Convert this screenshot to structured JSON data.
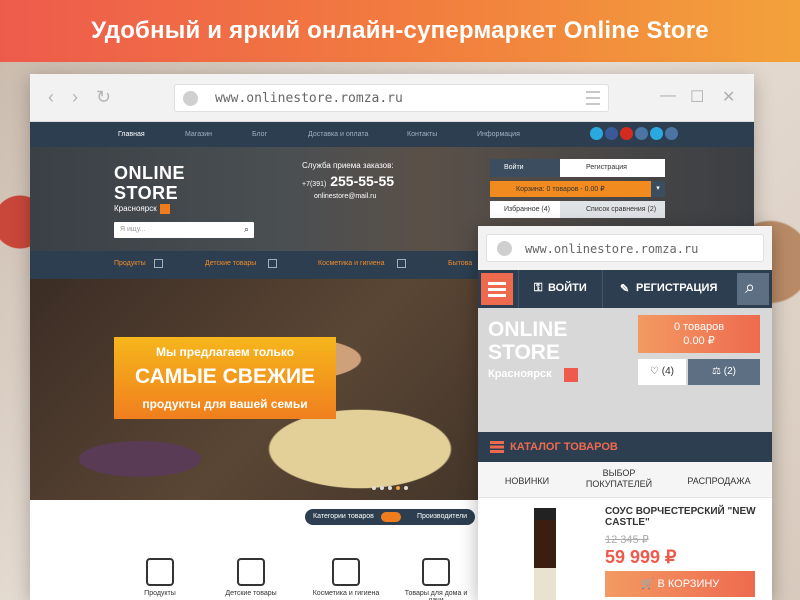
{
  "banner": {
    "title": "Удобный и яркий онлайн-супермаркет Online Store"
  },
  "desktop": {
    "url": "www.onlinestore.romza.ru",
    "topnav": [
      "Главная",
      "Магазин",
      "Блог",
      "Доставка и оплата",
      "Контакты",
      "Информация"
    ],
    "logo_line1": "ONLINE",
    "logo_line2": "STORE",
    "city": "Красноярск",
    "search_placeholder": "Я ищу...",
    "phone_label": "Служба приема заказов:",
    "phone_prefix": "+7(391)",
    "phone": "255-55-55",
    "email": "onlinestore@mail.ru",
    "login": "Войти",
    "register": "Регистрация",
    "cart": "Корзина: 0 товаров - 0.00 ₽",
    "favorites": "Избранное (4)",
    "compare": "Список сравнения (2)",
    "catnav": [
      "Продукты",
      "Детские товары",
      "Косметика и гигиена",
      "Бытова"
    ],
    "promo_line1": "Мы предлагаем только",
    "promo_line2": "САМЫЕ СВЕЖИЕ",
    "promo_line3": "продукты для вашей семьи",
    "toggle_left": "Категории товаров",
    "toggle_right": "Производители",
    "categories": [
      "Продукты",
      "Детские товары",
      "Косметика и гигиена",
      "Товары для дома и дачи"
    ]
  },
  "mobile": {
    "url": "www.onlinestore.romza.ru",
    "login": "ВОЙТИ",
    "register": "РЕГИСТРАЦИЯ",
    "logo_line1": "ONLINE",
    "logo_line2": "STORE",
    "city": "Красноярск",
    "cart_count": "0 товаров",
    "cart_sum": "0.00 ₽",
    "favorites": "(4)",
    "compare": "(2)",
    "catalog": "КАТАЛОГ ТОВАРОВ",
    "tabs": [
      "НОВИНКИ",
      "ВЫБОР ПОКУПАТЕЛЕЙ",
      "РАСПРОДАЖА"
    ],
    "product_name": "СОУС ВОРЧЕСТЕРСКИЙ \"NEW CASTLE\"",
    "old_price": "12 345 ₽",
    "price": "59 999 ₽",
    "buy": "В КОРЗИНУ"
  }
}
